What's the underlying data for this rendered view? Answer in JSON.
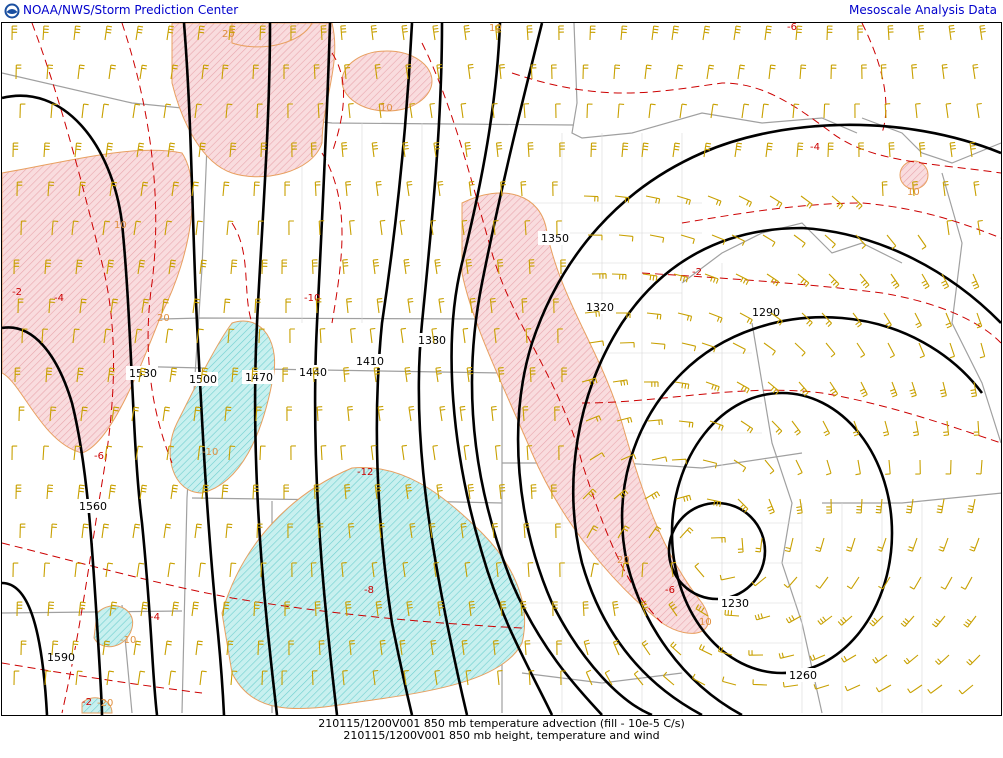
{
  "header": {
    "left_title": "NOAA/NWS/Storm Prediction Center",
    "right_title": "Mesoscale Analysis Data",
    "logo": "noaa-logo-icon"
  },
  "footer": {
    "line1": "210115/1200V001 850 mb temperature advection (fill - 10e-5 C/s)",
    "line2": "210115/1200V001 850 mb height, temperature and wind"
  },
  "map": {
    "height_labels": [
      "1530",
      "1500",
      "1470",
      "1440",
      "1410",
      "1380",
      "1350",
      "1320",
      "1290",
      "1560",
      "1590",
      "1230",
      "1260"
    ],
    "temperature_labels": [
      "-6",
      "-4",
      "-2",
      "-4",
      "-10",
      "-6",
      "-8",
      "-12",
      "-2",
      "-4",
      "-6",
      "-2"
    ],
    "advection_labels": [
      "20",
      "10",
      "20",
      "10",
      "20",
      "10",
      "10",
      "-10",
      "-10",
      "10",
      "-20"
    ],
    "colors": {
      "warm_advection": "#f7c8cc",
      "warm_outline": "#e8a060",
      "cold_advection": "#a8e8e8",
      "height_contour": "#000000",
      "temperature_contour": "#cc0000",
      "boundaries": "#a0a0a0",
      "wind_barbs": "#c8a000",
      "title_text": "#0000cc"
    }
  }
}
